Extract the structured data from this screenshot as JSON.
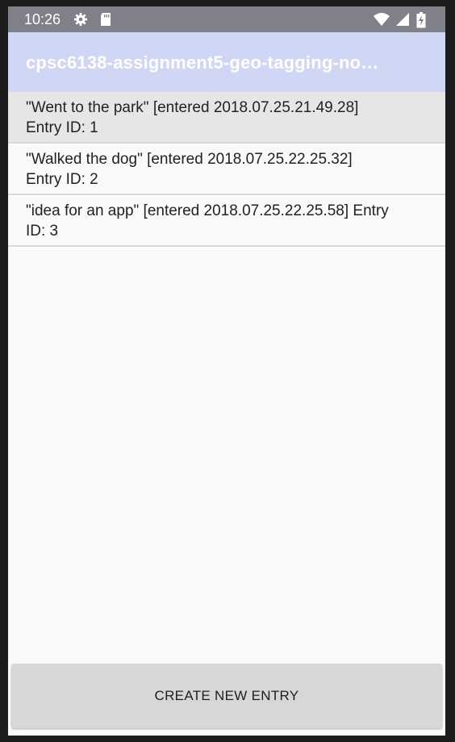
{
  "status_bar": {
    "time": "10:26",
    "icons": [
      "settings-gear-icon",
      "sd-card-icon",
      "wifi-icon",
      "cell-signal-icon",
      "battery-charging-icon"
    ]
  },
  "app_bar": {
    "title": "cpsc6138-assignment5-geo-tagging-no…"
  },
  "entries": [
    {
      "line1": "\"Went to the park\"  [entered 2018.07.25.21.49.28]",
      "line2": "Entry ID: 1",
      "selected": true
    },
    {
      "line1": "\"Walked the dog\"  [entered 2018.07.25.22.25.32]",
      "line2": "Entry ID: 2",
      "selected": false
    },
    {
      "line1": "\"idea for an app\"  [entered 2018.07.25.22.25.58] Entry",
      "line2": "ID: 3",
      "selected": false
    }
  ],
  "create_button": {
    "label": "CREATE NEW ENTRY"
  },
  "colors": {
    "status_bar": "#7f8088",
    "app_bar": "#cfd7f5",
    "selected_row": "#e6e6e6",
    "button": "#d6d7d7"
  }
}
